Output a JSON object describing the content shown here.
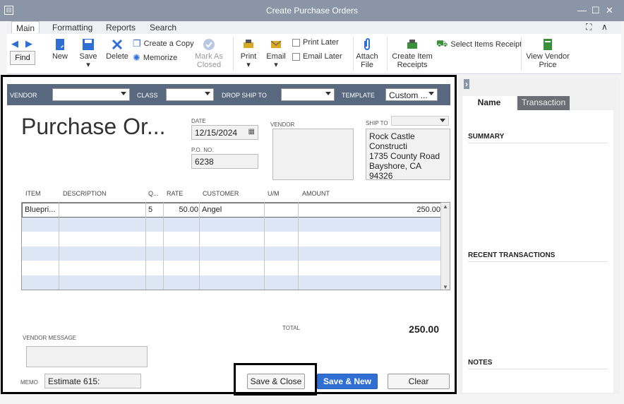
{
  "window": {
    "title": "Create Purchase Orders",
    "system_icon": "⊟",
    "min": "—",
    "max": "☐",
    "close": "✕"
  },
  "tabs": [
    {
      "label": "Main"
    },
    {
      "label": "Formatting"
    },
    {
      "label": "Reports"
    },
    {
      "label": "Search"
    }
  ],
  "tabs_right": {
    "expand": "⛶",
    "collapse": "∧"
  },
  "toolbar": {
    "find": "Find",
    "new": "New",
    "save": "Save",
    "delete": "Delete",
    "create_copy": "Create a Copy",
    "memorize": "Memorize",
    "mark_as_closed": "Mark As Closed",
    "print": "Print",
    "email": "Email",
    "print_later": "Print Later",
    "email_later": "Email Later",
    "attach_file": "Attach File",
    "create_item_receipts": "Create Item Receipts",
    "select_items_receipt": "Select Items Receipt",
    "view_vendor_price": "View Vendor Price"
  },
  "header": {
    "vendor_label": "VENDOR",
    "vendor_value": "",
    "class_label": "CLASS",
    "class_value": "",
    "drop_ship_label": "DROP SHIP TO",
    "drop_ship_value": "",
    "template_label": "TEMPLATE",
    "template_value": "Custom ..."
  },
  "form": {
    "title": "Purchase Or...",
    "date_label": "DATE",
    "date": "12/15/2024",
    "po_label": "P.O. NO.",
    "po_no": "6238",
    "vendor_label": "VENDOR",
    "vendor_address": "",
    "ship_to_label": "SHIP TO",
    "ship_to_select": "",
    "ship_to_address": [
      "Rock Castle Constructi",
      "1735 County Road",
      "Bayshore, CA 94326"
    ]
  },
  "table": {
    "columns": [
      "ITEM",
      "DESCRIPTION",
      "Q...",
      "RATE",
      "CUSTOMER",
      "U/M",
      "AMOUNT"
    ],
    "rows": [
      {
        "item": "Bluepri...",
        "description": "",
        "qty": "5",
        "rate": "50.00",
        "customer": "Angel",
        "um": "",
        "amount": "250.00"
      }
    ]
  },
  "footer": {
    "total_label": "TOTAL",
    "total": "250.00",
    "vendor_message_label": "VENDOR MESSAGE",
    "vendor_message": "",
    "memo_label": "MEMO",
    "memo": "Estimate 615:",
    "save_close": "Save & Close",
    "save_new": "Save & New",
    "clear": "Clear"
  },
  "right_panel": {
    "tabs": [
      {
        "label": "Name"
      },
      {
        "label": "Transaction"
      }
    ],
    "summary": "SUMMARY",
    "recent": "RECENT TRANSACTIONS",
    "notes": "NOTES"
  }
}
